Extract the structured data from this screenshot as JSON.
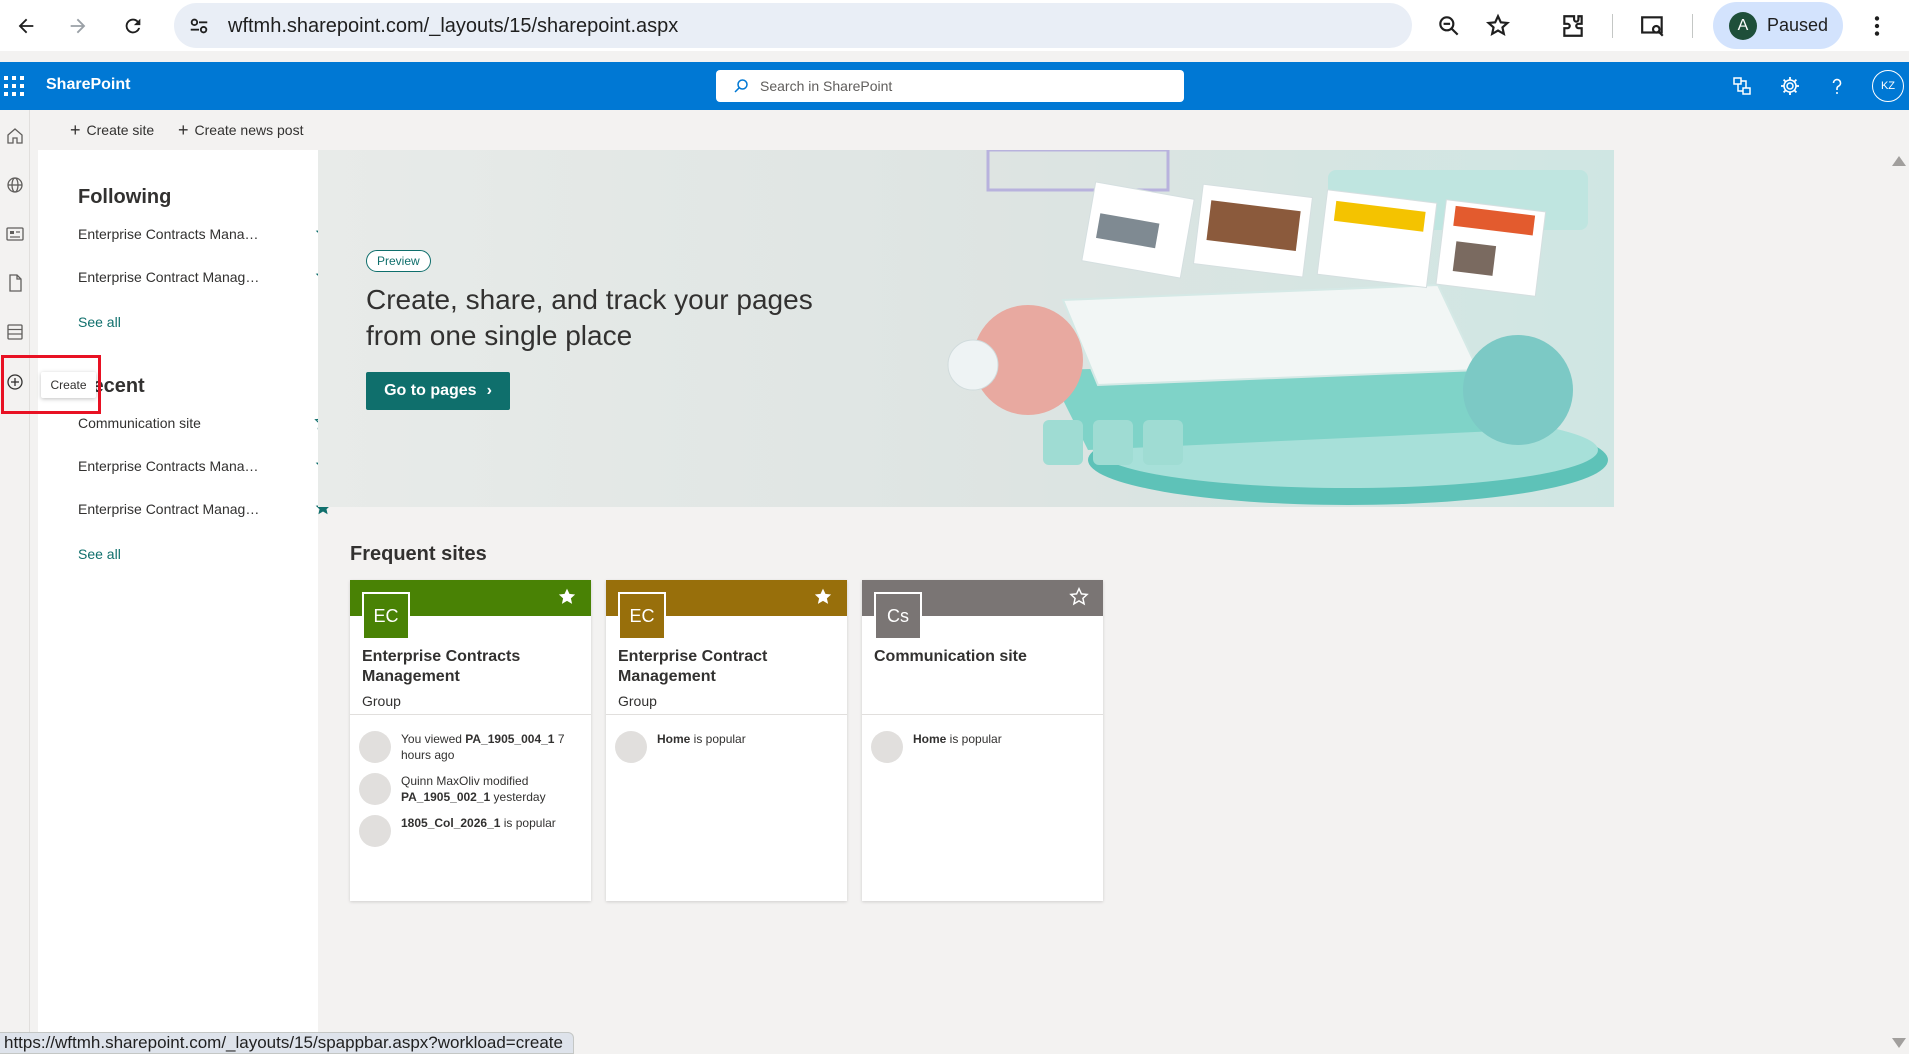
{
  "browser": {
    "url": "wftmh.sharepoint.com/_layouts/15/sharepoint.aspx",
    "profile_initial": "A",
    "profile_status": "Paused",
    "status_url": "https://wftmh.sharepoint.com/_layouts/15/spappbar.aspx?workload=create"
  },
  "suitebar": {
    "brand": "SharePoint",
    "search_placeholder": "Search in SharePoint",
    "user_initials": "KZ",
    "color": "#0078d4"
  },
  "commands": {
    "create_site": "Create site",
    "create_news_post": "Create news post"
  },
  "appbar": {
    "tooltip": "Create"
  },
  "leftnav": {
    "following_heading": "Following",
    "following": [
      {
        "label": "Enterprise Contracts Management",
        "starred": true
      },
      {
        "label": "Enterprise Contract Management",
        "starred": true
      }
    ],
    "see_all_1": "See all",
    "recent_heading": "Recent",
    "recent": [
      {
        "label": "Communication site",
        "starred": false
      },
      {
        "label": "Enterprise Contracts Management",
        "starred": true
      },
      {
        "label": "Enterprise Contract Management",
        "starred": true
      }
    ],
    "see_all_2": "See all"
  },
  "hero": {
    "badge": "Preview",
    "title": "Create, share, and track your pages from one single place",
    "button": "Go to pages"
  },
  "frequent": {
    "title": "Frequent sites",
    "cards": [
      {
        "initials": "EC",
        "color": "#498205",
        "name": "Enterprise Contracts Management",
        "kind": "Group",
        "starred": true,
        "activities": [
          {
            "pre": "You viewed ",
            "bold": "PA_1905_004_1",
            "post": " 7 hours ago"
          },
          {
            "pre": "Quinn MaxOliv modified ",
            "bold": "PA_1905_002_1",
            "post": " yesterday"
          },
          {
            "pre": "",
            "bold": "1805_Col_2026_1",
            "post": " is popular"
          }
        ]
      },
      {
        "initials": "EC",
        "color": "#986f0b",
        "name": "Enterprise Contract Management",
        "kind": "Group",
        "starred": true,
        "activities": [
          {
            "pre": "",
            "bold": "Home",
            "post": " is popular"
          }
        ]
      },
      {
        "initials": "Cs",
        "color": "#7a7574",
        "name": "Communication site",
        "kind": "",
        "starred": false,
        "activities": [
          {
            "pre": "",
            "bold": "Home",
            "post": " is popular"
          }
        ]
      }
    ]
  }
}
